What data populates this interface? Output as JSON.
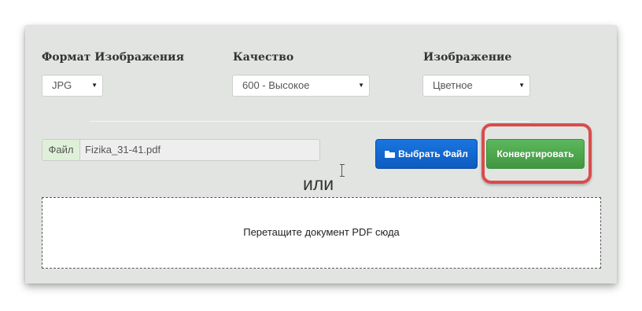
{
  "fields": {
    "format": {
      "label": "Формат Изображения",
      "value": "JPG"
    },
    "quality": {
      "label": "Качество",
      "value": "600 - Высокое"
    },
    "image": {
      "label": "Изображение",
      "value": "Цветное"
    }
  },
  "select_arrow": "▼",
  "file": {
    "addon": "Файл",
    "name": "Fizika_31-41.pdf"
  },
  "buttons": {
    "choose_file": "Выбрать Файл",
    "choose_file_icon": "folder-open-icon",
    "convert": "Конвертировать"
  },
  "or_text": "или",
  "dropzone": {
    "text": "Перетащите документ PDF сюда"
  },
  "colors": {
    "panel_bg": "#e2e4e2",
    "blue_button": "#0d5bbf",
    "green_button": "#4cae4c",
    "highlight": "#d94c4c",
    "file_addon_bg": "#dff0d8"
  }
}
